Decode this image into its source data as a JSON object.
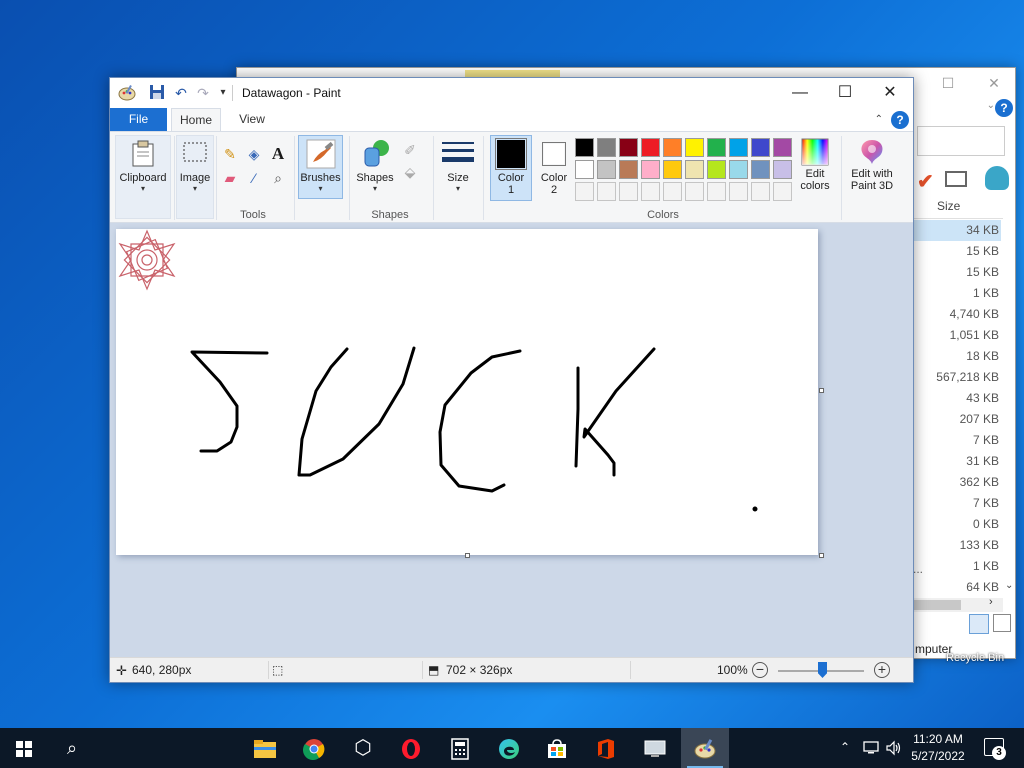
{
  "window": {
    "title": "Datawagon - Paint",
    "minimize": "—",
    "maximize": "☐",
    "close": "✕"
  },
  "tabs": {
    "file": "File",
    "home": "Home",
    "view": "View"
  },
  "ribbon": {
    "clipboard": "Clipboard",
    "image": "Image",
    "tools_group": "Tools",
    "brushes": "Brushes",
    "shapes": "Shapes",
    "shapes_group": "Shapes",
    "size": "Size",
    "color1_line1": "Color",
    "color1_line2": "1",
    "color2_line1": "Color",
    "color2_line2": "2",
    "colors_group": "Colors",
    "edit_colors_line1": "Edit",
    "edit_colors_line2": "colors",
    "paint3d_line1": "Edit with",
    "paint3d_line2": "Paint 3D"
  },
  "colors": {
    "color1": "#000000",
    "color2": "#ffffff",
    "row1": [
      "#000000",
      "#7f7f7f",
      "#880015",
      "#ed1c24",
      "#ff7f27",
      "#fff200",
      "#22b14c",
      "#00a2e8",
      "#3f48cc",
      "#a349a4"
    ],
    "row2": [
      "#ffffff",
      "#c3c3c3",
      "#b97a57",
      "#ffaec9",
      "#ffc90e",
      "#efe4b0",
      "#b5e61d",
      "#99d9ea",
      "#7092be",
      "#c8bfe7"
    ]
  },
  "status": {
    "cursor_pos": "640, 280px",
    "image_size": "702 × 326px",
    "zoom": "100%",
    "zoom_out": "−",
    "zoom_in": "+"
  },
  "explorer": {
    "size_header": "Size",
    "sizes": [
      "34 KB",
      "15 KB",
      "15 KB",
      "1 KB",
      "4,740 KB",
      "1,051 KB",
      "18 KB",
      "567,218 KB",
      "43 KB",
      "207 KB",
      "7 KB",
      "31 KB",
      "362 KB",
      "7 KB",
      "0 KB",
      "133 KB",
      "1 KB",
      "64 KB"
    ],
    "dots": "...",
    "status_partial": "mputer"
  },
  "taskbar": {
    "time": "11:20 AM",
    "date": "5/27/2022",
    "notifications": "3",
    "recycle_bin": "Recycle Bin"
  }
}
